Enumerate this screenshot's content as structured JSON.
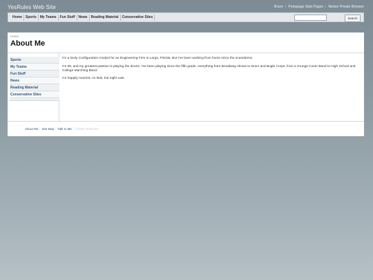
{
  "site": {
    "title": "YesRules Web Site"
  },
  "toplinks": [
    "Brave",
    "Protopage Start Pages",
    "Norton Private Browser"
  ],
  "nav": [
    "Home",
    "Sports",
    "My Teams",
    "Fun Stuff",
    "News",
    "Reading Material",
    "Conservative Sites"
  ],
  "search": {
    "button": "Search",
    "placeholder": ""
  },
  "page": {
    "breadcrumb": "Home",
    "title": "About Me",
    "paragraphs": [
      "I'm a lowly Configuration Analyst for an Engineering Firm in Largo, Florida. But I've been working from home since the scamdemic.",
      "I'm 65, and my greatest passion is playing the drums. I've been playing since the fifth grade, everything from Broadway shows to Drum and Bugle Corps, from a Grunge Cover Band to High School and College Marching Band.",
      "I'm happily married, no kids, but eight cats."
    ]
  },
  "sidebar": [
    "Sports",
    "My Teams",
    "Fun Stuff",
    "News",
    "Reading Material",
    "Conservative Sites"
  ],
  "footer": {
    "links": [
      "About Me",
      "Site Map",
      "Talk to Me"
    ],
    "copyright": "©2025 YesRules"
  }
}
